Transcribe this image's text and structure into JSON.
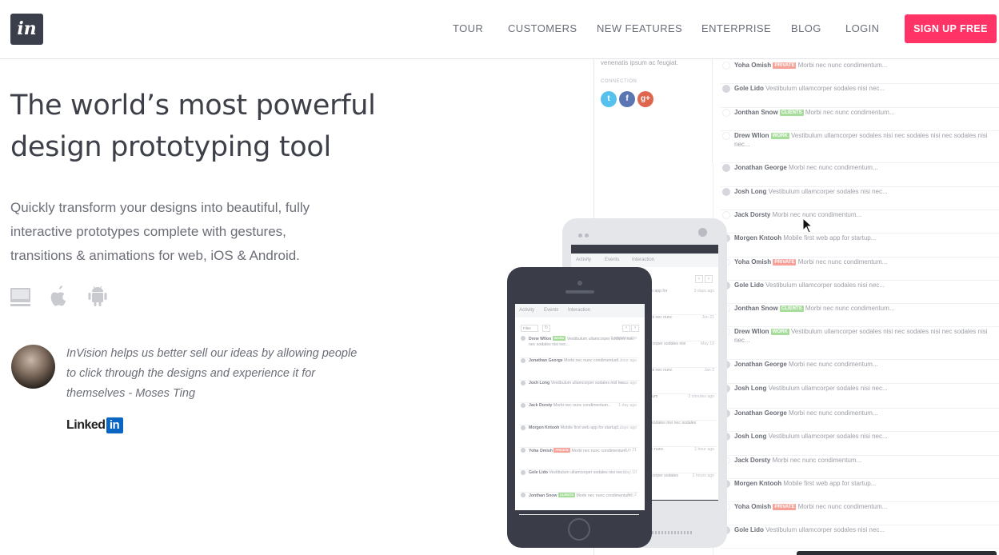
{
  "header": {
    "logo_text": "in",
    "nav": [
      "TOUR",
      "CUSTOMERS",
      "NEW FEATURES",
      "ENTERPRISE",
      "BLOG",
      "LOGIN"
    ],
    "signup_label": "SIGN UP FREE"
  },
  "hero": {
    "headline_line1": "The world’s most powerful",
    "headline_line2": "design prototyping tool",
    "subline": "Quickly transform your designs into beautiful, fully interactive prototypes complete with gestures, transitions & animations for web, iOS & Android.",
    "platform_icons": [
      "desktop-icon",
      "apple-icon",
      "android-icon"
    ]
  },
  "testimonial": {
    "quote": "InVision helps us better sell our ideas by allowing people to click through the designs and experience it for themselves - Moses Ting",
    "company_text": "Linked",
    "company_badge": "in"
  },
  "mockup": {
    "side_text": "venenatis ipsum ac feugiat.",
    "side_label": "CONNECTION",
    "social": [
      "t",
      "f",
      "g+"
    ],
    "feed": [
      {
        "name": "Yoha Omish",
        "tag": "PRIVATE",
        "text": "Morbi nec nunc condimentum...",
        "dot": false
      },
      {
        "name": "Gole Lido",
        "tag": "",
        "text": "Vestibulum ullamcorper sodales nisi nec...",
        "dot": true
      },
      {
        "name": "Jonthan Snow",
        "tag": "CLIENTS",
        "text": "Morbi nec nunc condimentum...",
        "dot": false
      },
      {
        "name": "Drew Wllon",
        "tag": "WORK",
        "text": "Vestibulum ullamcorper sodales nisi nec sodales nisi nec sodales nisi nec...",
        "dot": false
      },
      {
        "name": "Jonathan George",
        "tag": "",
        "text": "Morbi nec nunc condimentum...",
        "dot": true
      },
      {
        "name": "Josh Long",
        "tag": "",
        "text": "Vestibulum ullamcorper sodales nisi nec...",
        "dot": true
      },
      {
        "name": "Jack Dorsty",
        "tag": "",
        "text": "Morbi nec nunc condimentum...",
        "dot": false
      },
      {
        "name": "Morgen Kntooh",
        "tag": "",
        "text": "Mobile first web app for startup...",
        "dot": true
      },
      {
        "name": "Yoha Omish",
        "tag": "PRIVATE",
        "text": "Morbi nec nunc condimentum...",
        "dot": false
      },
      {
        "name": "Gole Lido",
        "tag": "",
        "text": "Vestibulum ullamcorper sodales nisi nec...",
        "dot": true
      },
      {
        "name": "Jonthan Snow",
        "tag": "CLIENTS",
        "text": "Morbi nec nunc condimentum...",
        "dot": false
      },
      {
        "name": "Drew Wllon",
        "tag": "WORK",
        "text": "Vestibulum ullamcorper sodales nisi nec sodales nisi nec sodales nisi nec...",
        "dot": false
      },
      {
        "name": "Jonathan George",
        "tag": "",
        "text": "Morbi nec nunc condimentum...",
        "dot": true
      },
      {
        "name": "Josh Long",
        "tag": "",
        "text": "Vestibulum ullamcorper sodales nisi nec...",
        "dot": true
      },
      {
        "name": "Jonathan George",
        "tag": "",
        "text": "Morbi nec nunc condimentum...",
        "dot": true
      },
      {
        "name": "Josh Long",
        "tag": "",
        "text": "Vestibulum ullamcorper sodales nisi nec...",
        "dot": true
      },
      {
        "name": "Jack Dorsty",
        "tag": "",
        "text": "Morbi nec nunc condimentum...",
        "dot": false
      },
      {
        "name": "Morgen Kntooh",
        "tag": "",
        "text": "Mobile first web app for startup...",
        "dot": true
      },
      {
        "name": "Yoha Omish",
        "tag": "PRIVATE",
        "text": "Morbi nec nunc condimentum...",
        "dot": false
      },
      {
        "name": "Gole Lido",
        "tag": "",
        "text": "Vestibulum ullamcorper sodales nisi nec...",
        "dot": true
      }
    ],
    "mini_tabs": [
      "Activity",
      "Events",
      "Interaction"
    ],
    "mini_filter": "Filter",
    "mini_feed": [
      {
        "name": "Drew Wllon",
        "tag": "WORK",
        "text": "Vestibulum ullamcorper sodales nisi nec sodales nisi nec...",
        "time": "3 minutes ago"
      },
      {
        "name": "Jonathan George",
        "tag": "",
        "text": "Morbi nec nunc condimentum...",
        "time": "1 hour ago"
      },
      {
        "name": "Josh Long",
        "tag": "",
        "text": "Vestibulum ullamcorper sodales nisi nec...",
        "time": "2 hours ago"
      },
      {
        "name": "Jack Dorsty",
        "tag": "",
        "text": "Morbi nec nunc condimentum...",
        "time": "1 day ago"
      },
      {
        "name": "Morgen Kntooh",
        "tag": "",
        "text": "Mobile first web app for startup...",
        "time": "3 days ago"
      },
      {
        "name": "Yoha Omish",
        "tag": "PRIVATE",
        "text": "Morbi nec nunc condimentum...",
        "time": "Jun 21"
      },
      {
        "name": "Gole Lido",
        "tag": "",
        "text": "Vestibulum ullamcorper sodales nisi nec...",
        "time": "May 10"
      },
      {
        "name": "Jonthan Snow",
        "tag": "CLIENTS",
        "text": "Morbi nec nunc condimentum...",
        "time": "Jan 2"
      }
    ],
    "tablet_snippets": [
      {
        "text": "b app for",
        "time": "3 days ago"
      },
      {
        "text": "bi nec nunc",
        "time": "Jun 21"
      },
      {
        "text": "corper sodales nisi",
        "time": "May 10"
      },
      {
        "text": "bi nec nunc",
        "time": "Jan 2"
      },
      {
        "text": "lum",
        "time": "3 minutes ago"
      },
      {
        "text": "sodales nisi nec sodales",
        "time": ""
      },
      {
        "text": "c nunc",
        "time": "1 hour ago"
      },
      {
        "text": "corper sodales",
        "time": "2 hours ago"
      }
    ]
  },
  "colors": {
    "accent": "#ff3366",
    "logo_bg": "#3b3f4c",
    "device_dark": "#3a3d48",
    "device_light": "#e4e6ea"
  }
}
